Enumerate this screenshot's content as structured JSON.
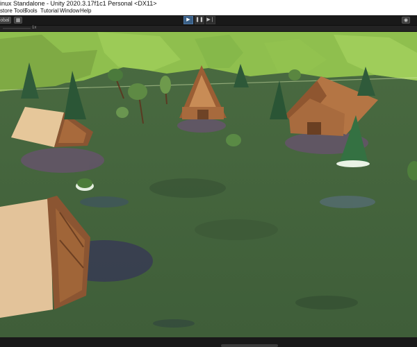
{
  "window": {
    "title": "inux Standalone - Unity 2020.3.17f1c1 Personal <DX11>"
  },
  "menu": {
    "items": [
      "store Tools",
      "Tools",
      "Tutorial",
      "Window",
      "Help"
    ]
  },
  "toolbar": {
    "left_button_label": "obal",
    "play_icon": "play-icon",
    "pause_icon": "pause-icon",
    "step_icon": "step-icon",
    "play_active": true
  },
  "game_view": {
    "scale_label": "1x"
  },
  "colors": {
    "accent": "#3a5f85",
    "editor_dark": "#191919",
    "water": "#4f7345",
    "hills": "#8fbf4e"
  }
}
